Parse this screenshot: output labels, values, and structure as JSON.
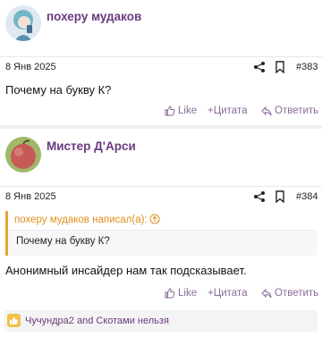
{
  "posts": [
    {
      "username": "похеру мудаков",
      "date": "8 Янв 2025",
      "number": "#383",
      "body": "Почему на букву К?",
      "actions": {
        "like": "Like",
        "quote": "+Цитата",
        "reply": "Ответить"
      }
    },
    {
      "username": "Мистер Д'Арси",
      "date": "8 Янв 2025",
      "number": "#384",
      "quote": {
        "author": "похеру мудаков написал(а):",
        "text": "Почему на букву К?"
      },
      "body": "Анонимный инсайдер нам так подсказывает.",
      "actions": {
        "like": "Like",
        "quote": "+Цитата",
        "reply": "Ответить"
      },
      "reactions": "Чучундра2 and Скотами нельзя"
    }
  ],
  "colors": {
    "username": "#6b3a7d",
    "quote_accent": "#e7a437",
    "reaction_icon": "#f2c14a"
  },
  "icons": [
    "avatar-anime",
    "avatar-apple",
    "share-icon",
    "bookmark-icon",
    "thumb-up-icon",
    "reply-icon",
    "arrow-up-circle-icon"
  ]
}
